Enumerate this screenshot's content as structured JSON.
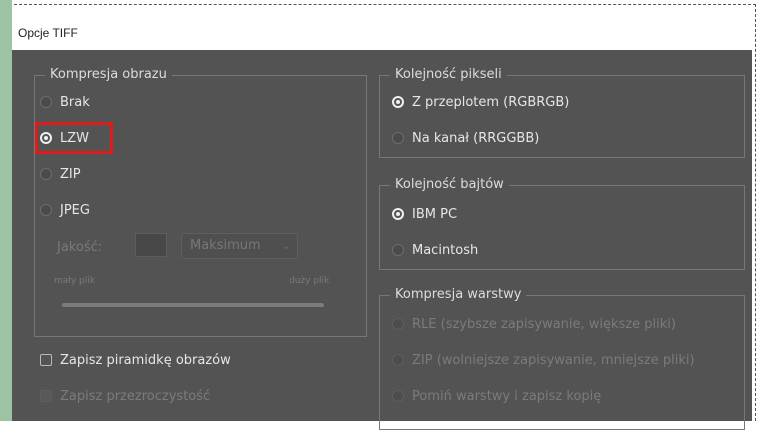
{
  "dialog": {
    "title": "Opcje TIFF"
  },
  "image_compression": {
    "title": "Kompresja obrazu",
    "options": [
      "Brak",
      "LZW",
      "ZIP",
      "JPEG"
    ],
    "selected": "LZW",
    "quality_label": "Jakość:",
    "quality_select": "Maksimum",
    "small_file": "mały plik",
    "large_file": "duży plik"
  },
  "pixel_order": {
    "title": "Kolejność pikseli",
    "options": [
      "Z przeplotem (RGBRGB)",
      "Na kanał (RRGGBB)"
    ],
    "selected": "Z przeplotem (RGBRGB)"
  },
  "byte_order": {
    "title": "Kolejność bajtów",
    "options": [
      "IBM PC",
      "Macintosh"
    ],
    "selected": "IBM PC"
  },
  "layer_compression": {
    "title": "Kompresja warstwy",
    "options": [
      "RLE (szybsze zapisywanie, większe pliki)",
      "ZIP (wolniejsze zapisywanie, mniejsze pliki)",
      "Pomiń warstwy i zapisz kopię"
    ]
  },
  "checkboxes": {
    "save_pyramid": "Zapisz piramidkę obrazów",
    "save_transparency": "Zapisz przezroczystość"
  },
  "colors": {
    "highlight": "#e01b1b",
    "dialog_bg": "#535353",
    "accent_strip": "#9cc3a3"
  }
}
